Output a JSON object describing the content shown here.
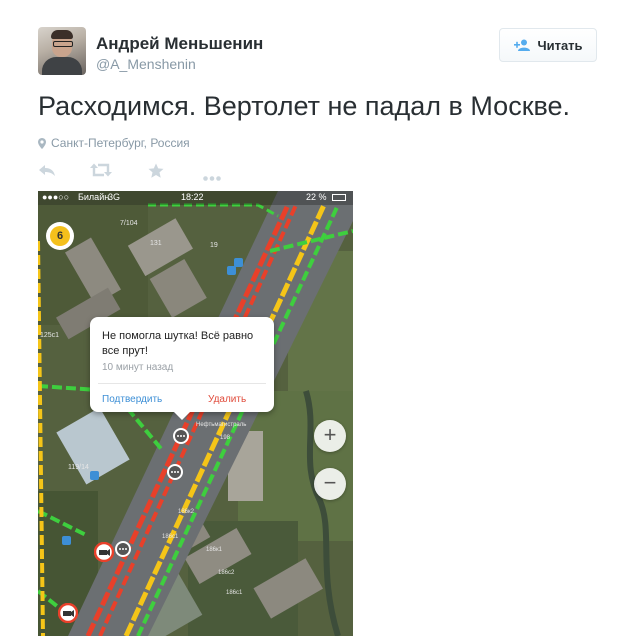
{
  "author": {
    "name": "Андрей Меньшенин",
    "handle": "@A_Menshenin"
  },
  "follow_button": {
    "label": "Читать",
    "icon": "add-user-icon"
  },
  "tweet": {
    "text": "Расходимся. Вертолет не падал в Москве.",
    "location": "Санкт-Петербург, Россия"
  },
  "actions": {
    "reply_icon": "reply-icon",
    "retweet_icon": "retweet-icon",
    "favorite_icon": "star-icon",
    "more_icon": "more-icon"
  },
  "screenshot": {
    "status": {
      "carrier": "Билайн",
      "network": "3G",
      "time": "18:22",
      "battery": "22 %"
    },
    "traffic_level": "6",
    "popup": {
      "message": "Не помогла шутка! Всё равно все прут!",
      "time": "10 минут назад",
      "confirm": "Подтвердить",
      "delete": "Удалить"
    },
    "zoom_in": "+",
    "zoom_out": "−",
    "map_labels": [
      "7/104",
      "131",
      "19",
      "125с1",
      "119/14",
      "Нефтьмагистраль",
      "198",
      "186к2",
      "186с1",
      "186к1",
      "186с2",
      "186с1"
    ],
    "colors": {
      "traffic_green": "#3ecf3e",
      "traffic_yellow": "#f5c518",
      "traffic_red": "#e8402a",
      "link_blue": "#3d8fd6",
      "delete_red": "#e04a3a"
    }
  }
}
